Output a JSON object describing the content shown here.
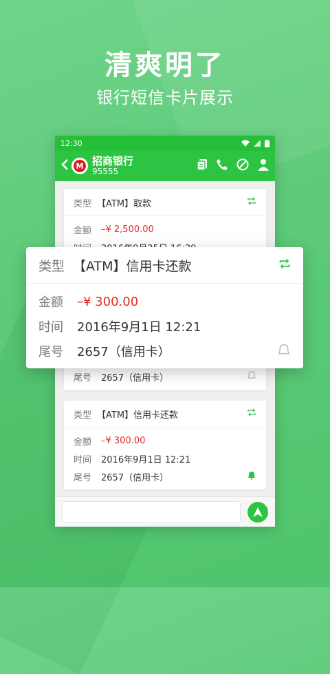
{
  "hero": {
    "title": "清爽明了",
    "subtitle": "银行短信卡片展示"
  },
  "status_bar": {
    "time": "12:30"
  },
  "app_bar": {
    "bank_name": "招商银行",
    "bank_number": "95555",
    "logo_letter": "M"
  },
  "cards": [
    {
      "type_label": "类型",
      "type_value": "【ATM】取款",
      "amount_label": "金额",
      "amount_value": "–¥ 2,500.00",
      "time_label": "时间",
      "time_value": "2016年9月25日 16:39"
    },
    {
      "tail_label": "尾号",
      "tail_value": "2657（信用卡）"
    },
    {
      "type_label": "类型",
      "type_value": "【ATM】信用卡还款",
      "amount_label": "金额",
      "amount_value": "–¥ 300.00",
      "time_label": "时间",
      "time_value": "2016年9月1日 12:21",
      "tail_label": "尾号",
      "tail_value": "2657（信用卡）"
    }
  ],
  "zoom_card": {
    "type_label": "类型",
    "type_value": "【ATM】信用卡还款",
    "amount_label": "金额",
    "amount_value": "–¥ 300.00",
    "time_label": "时间",
    "time_value": "2016年9月1日 12:21",
    "tail_label": "尾号",
    "tail_value": "2657（信用卡）"
  },
  "colors": {
    "accent": "#2ec443",
    "amount": "#e02a2a"
  }
}
